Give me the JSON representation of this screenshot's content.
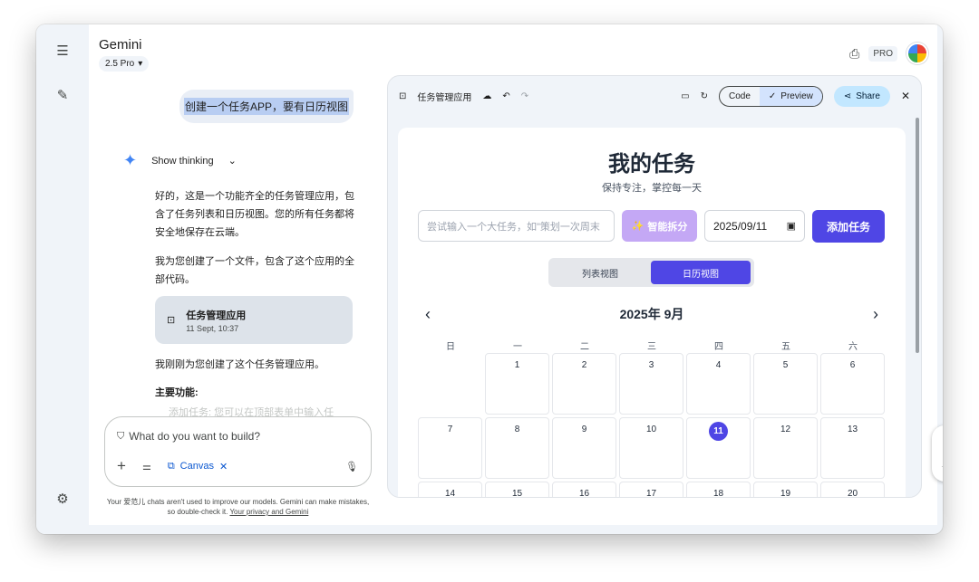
{
  "app": {
    "brand": "Gemini",
    "model": "2.5 Pro",
    "pro_badge": "PRO"
  },
  "chat": {
    "user_message": "创建一个任务APP，要有日历视图",
    "show_thinking": "Show thinking",
    "paragraphs": [
      "好的，这是一个功能齐全的任务管理应用，包含了任务列表和日历视图。您的所有任务都将安全地保存在云端。",
      "我为您创建了一个文件，包含了这个应用的全部代码。"
    ],
    "file_card": {
      "title": "任务管理应用",
      "timestamp": "11 Sept, 10:37"
    },
    "after_text": "我刚刚为您创建了这个任务管理应用。",
    "features_heading": "主要功能:",
    "faded_text": "添加任务: 您可以在顶部表单中输入任",
    "input_placeholder": "What do you want to build?",
    "canvas_chip": "Canvas",
    "disclaimer_1": "Your 爱范儿 chats aren't used to improve our models. Gemini can make mistakes, so double-check it.",
    "disclaimer_link": "Your privacy and Gemini"
  },
  "canvas": {
    "title": "任务管理应用",
    "code_label": "Code",
    "preview_label": "Preview",
    "share_label": "Share"
  },
  "task_app": {
    "title": "我的任务",
    "subtitle": "保持专注，掌控每一天",
    "input_placeholder": "尝试输入一个大任务，如\"策划一次周末",
    "ai_button": "智能拆分",
    "date_value": "2025/09/11",
    "add_button": "添加任务",
    "tab_list": "列表视图",
    "tab_calendar": "日历视图",
    "month_label": "2025年 9月",
    "weekdays": [
      "日",
      "一",
      "二",
      "三",
      "四",
      "五",
      "六"
    ],
    "today": "11",
    "days": [
      "1",
      "2",
      "3",
      "4",
      "5",
      "6",
      "7",
      "8",
      "9",
      "10",
      "11",
      "12",
      "13",
      "14",
      "15",
      "16",
      "17",
      "18",
      "19",
      "20"
    ]
  }
}
